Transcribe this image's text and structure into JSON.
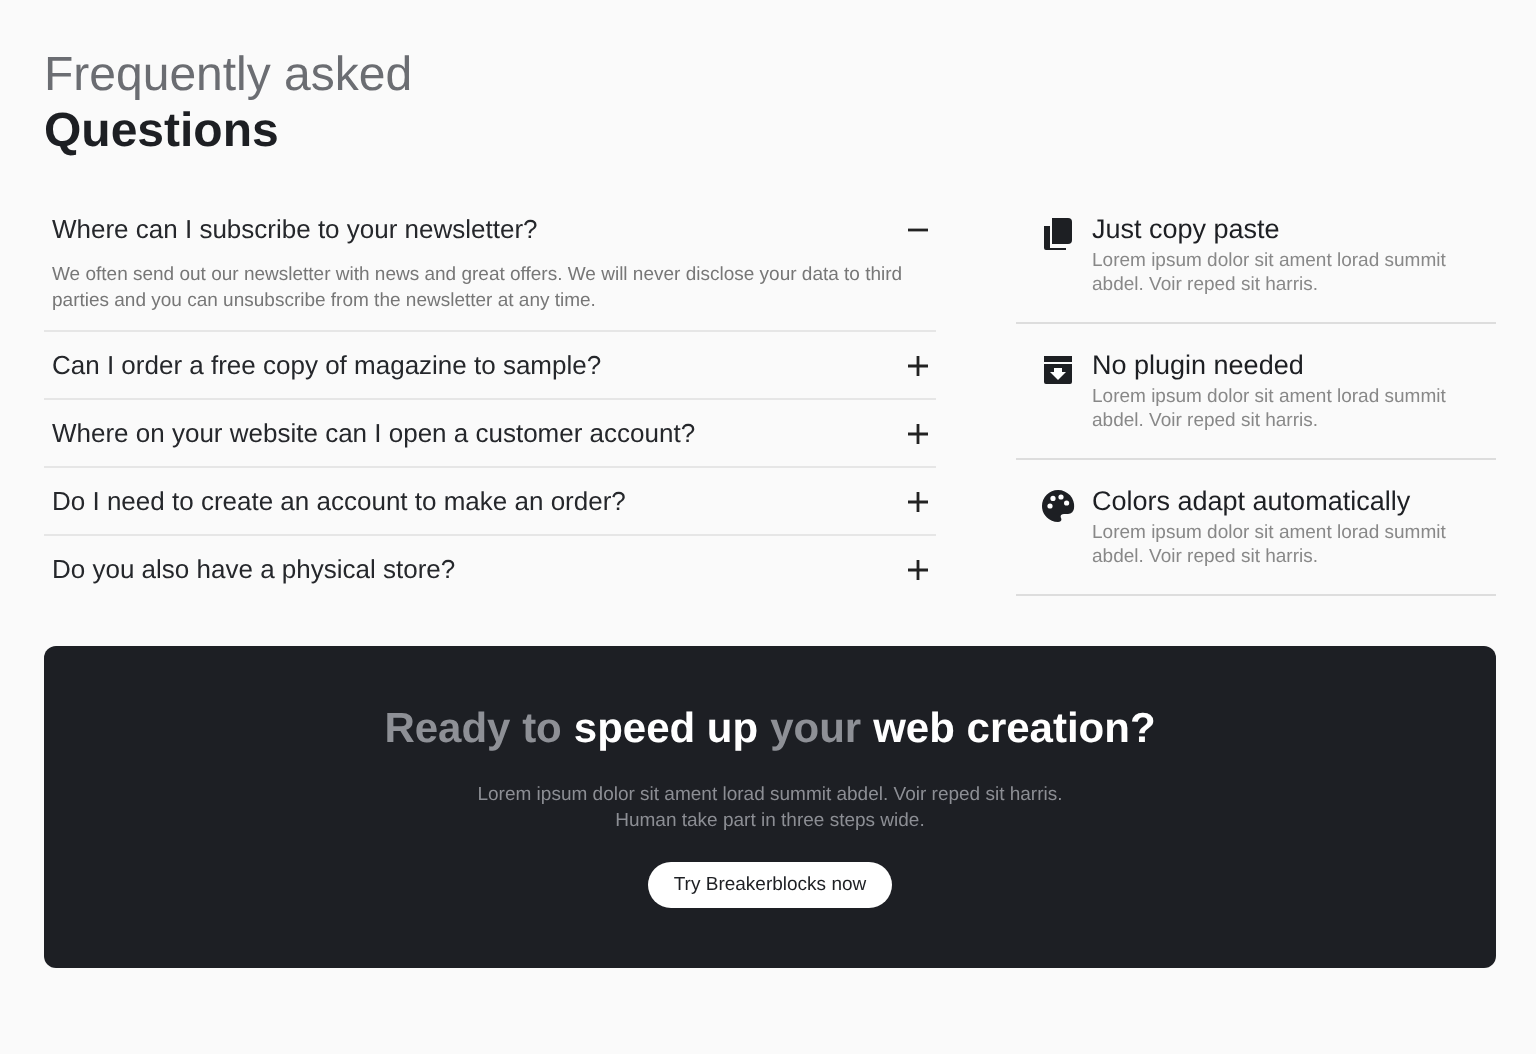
{
  "heading": {
    "light": "Frequently asked",
    "bold": "Questions"
  },
  "faq": [
    {
      "question": "Where can I subscribe to your newsletter?",
      "expanded": true,
      "answer": "We often send out our newsletter with news and great offers. We will never disclose your data to third parties and you can unsubscribe from the newsletter at any time."
    },
    {
      "question": "Can I order a free copy of magazine to sample?",
      "expanded": false
    },
    {
      "question": "Where on your website can I open a customer account?",
      "expanded": false
    },
    {
      "question": "Do I need to create an account to make an order?",
      "expanded": false
    },
    {
      "question": "Do you also have a physical store?",
      "expanded": false
    }
  ],
  "features": [
    {
      "title": "Just copy paste",
      "text": "Lorem ipsum dolor sit ament lorad summit abdel. Voir reped sit harris."
    },
    {
      "title": "No plugin needed",
      "text": "Lorem ipsum dolor sit ament lorad summit abdel. Voir reped sit harris."
    },
    {
      "title": "Colors adapt automatically",
      "text": "Lorem ipsum dolor sit ament lorad summit abdel. Voir reped sit harris."
    }
  ],
  "cta": {
    "title_parts": [
      {
        "text": "Ready to",
        "highlight": false
      },
      {
        "text": "speed up",
        "highlight": true
      },
      {
        "text": "your",
        "highlight": false
      },
      {
        "text": "web creation?",
        "highlight": true
      }
    ],
    "lines": [
      "Lorem ipsum dolor sit ament lorad summit abdel. Voir reped sit harris.",
      "Human take part in three steps wide."
    ],
    "button": "Try Breakerblocks now"
  }
}
